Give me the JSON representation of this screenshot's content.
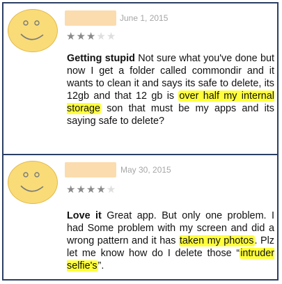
{
  "reviews": [
    {
      "date": "June 1, 2015",
      "rating": 3,
      "max_rating": 5,
      "title": "Getting stupid",
      "text_before": " Not sure what you've done but now I get a folder called commondir and it wants to clean it and says its safe to delete, its 12gb and that 12 gb is ",
      "highlight_1": "over half my internal storage",
      "text_middle": " son that must be my apps and its saying safe to delete?",
      "highlight_2": "",
      "text_after": ""
    },
    {
      "date": "May 30, 2015",
      "rating": 4,
      "max_rating": 5,
      "title": "Love it",
      "text_before": " Great app. But only one problem. I had Some problem with my screen and did a wrong pattern and it has ",
      "highlight_1": "taken my photos",
      "text_middle": ". Plz let me know how do I delete those “",
      "highlight_2": "intruder selfie's",
      "text_after": "”."
    }
  ],
  "colors": {
    "avatar_fill": "#f9dc78",
    "name_redaction": "#fbdcae",
    "highlight": "#ffff3a",
    "frame": "#2b3f63"
  },
  "icons": {
    "avatar": "smiley-face-icon",
    "star": "star-icon"
  }
}
